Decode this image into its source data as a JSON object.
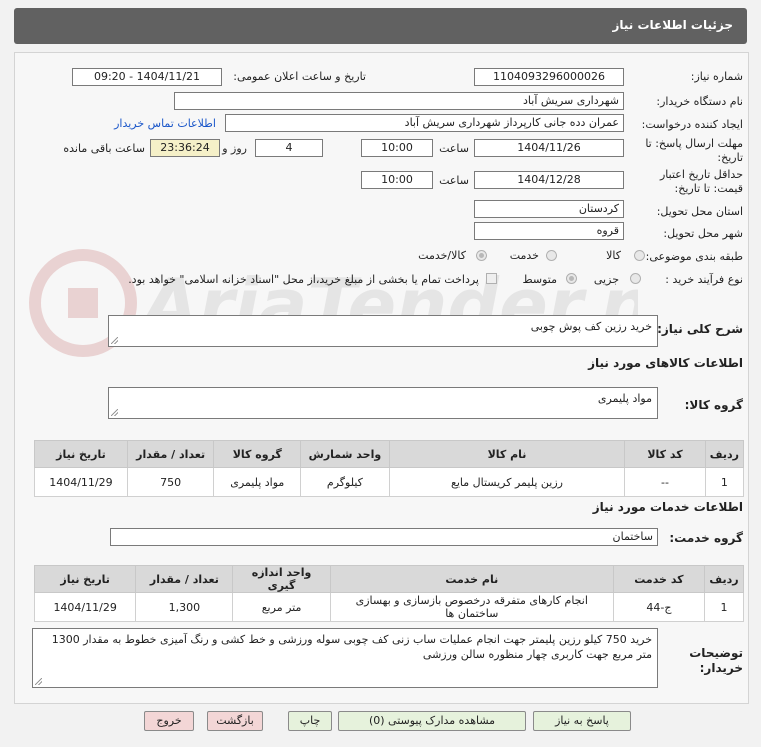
{
  "header": {
    "title": "جزئیات اطلاعات نیاز"
  },
  "fields": {
    "need_number_label": "شماره نیاز:",
    "need_number": "1104093296000026",
    "announce_label": "تاریخ و ساعت اعلان عمومی:",
    "announce_value": "1404/11/21 - 09:20",
    "buyer_org_label": "نام دستگاه خریدار:",
    "buyer_org": "شهرداری سریش آباد",
    "creator_label": "ایجاد کننده درخواست:",
    "creator": "عمران دده جانی کارپرداز شهرداری سریش آباد",
    "contact_link": "اطلاعات تماس خریدار",
    "deadline_label_1": "مهلت ارسال پاسخ: تا",
    "deadline_label_2": "تاریخ:",
    "deadline_date": "1404/11/26",
    "time_label": "ساعت",
    "deadline_time": "10:00",
    "days_value": "4",
    "days_label": "روز و",
    "remaining_time": "23:36:24",
    "remaining_label": "ساعت باقی مانده",
    "validity_label_1": "حداقل تاریخ اعتبار",
    "validity_label_2": "قیمت: تا تاریخ:",
    "validity_date": "1404/12/28",
    "validity_time": "10:00",
    "province_label": "استان محل تحویل:",
    "province": "کردستان",
    "city_label": "شهر محل تحویل:",
    "city": "قروه",
    "category_label": "طبقه بندی موضوعی:",
    "category_options": [
      "کالا",
      "خدمت",
      "کالا/خدمت"
    ],
    "process_label": "نوع فرآیند خرید :",
    "process_options": [
      "جزیی",
      "متوسط"
    ],
    "payment_note": "پرداخت تمام یا بخشی از مبلغ خرید،از محل \"اسناد خزانه اسلامی\" خواهد بود."
  },
  "description": {
    "label": "شرح کلی نیاز:",
    "value": "خرید رزین کف پوش چوبی"
  },
  "goods": {
    "section_title": "اطلاعات کالاهای مورد نیاز",
    "group_label": "گروه کالا:",
    "group_value": "مواد پلیمری",
    "columns": [
      "ردیف",
      "کد کالا",
      "نام کالا",
      "واحد شمارش",
      "گروه کالا",
      "تعداد / مقدار",
      "تاریخ نیاز"
    ],
    "rows": [
      [
        "1",
        "--",
        "رزین پلیمر کریستال مایع",
        "کیلوگرم",
        "مواد پلیمری",
        "750",
        "1404/11/29"
      ]
    ]
  },
  "services": {
    "section_title": "اطلاعات خدمات مورد نیاز",
    "group_label": "گروه خدمت:",
    "group_value": "ساختمان",
    "columns": [
      "ردیف",
      "کد خدمت",
      "نام خدمت",
      "واحد اندازه گیری",
      "تعداد / مقدار",
      "تاریخ نیاز"
    ],
    "rows": [
      [
        "1",
        "ج-44",
        "انجام کارهای متفرقه درخصوص بازسازی و بهسازی ساختمان ها",
        "متر مربع",
        "1,300",
        "1404/11/29"
      ]
    ]
  },
  "buyer_notes": {
    "label_1": "توضیحات",
    "label_2": "خریدار:",
    "value": "خرید 750 کیلو رزین پلیمتر جهت انجام عملیات ساب زنی کف چوبی سوله ورزشی و خط کشی و رنگ آمیزی خطوط  به مقدار 1300 متر مربع جهت کاربری چهار منظوره سالن ورزشی"
  },
  "buttons": {
    "reply": "پاسخ به نیاز",
    "docs": "مشاهده مدارک پیوستی (0)",
    "print": "چاپ",
    "back": "بازگشت",
    "exit": "خروج"
  },
  "watermark": {
    "text": "AriaTender.neT"
  }
}
